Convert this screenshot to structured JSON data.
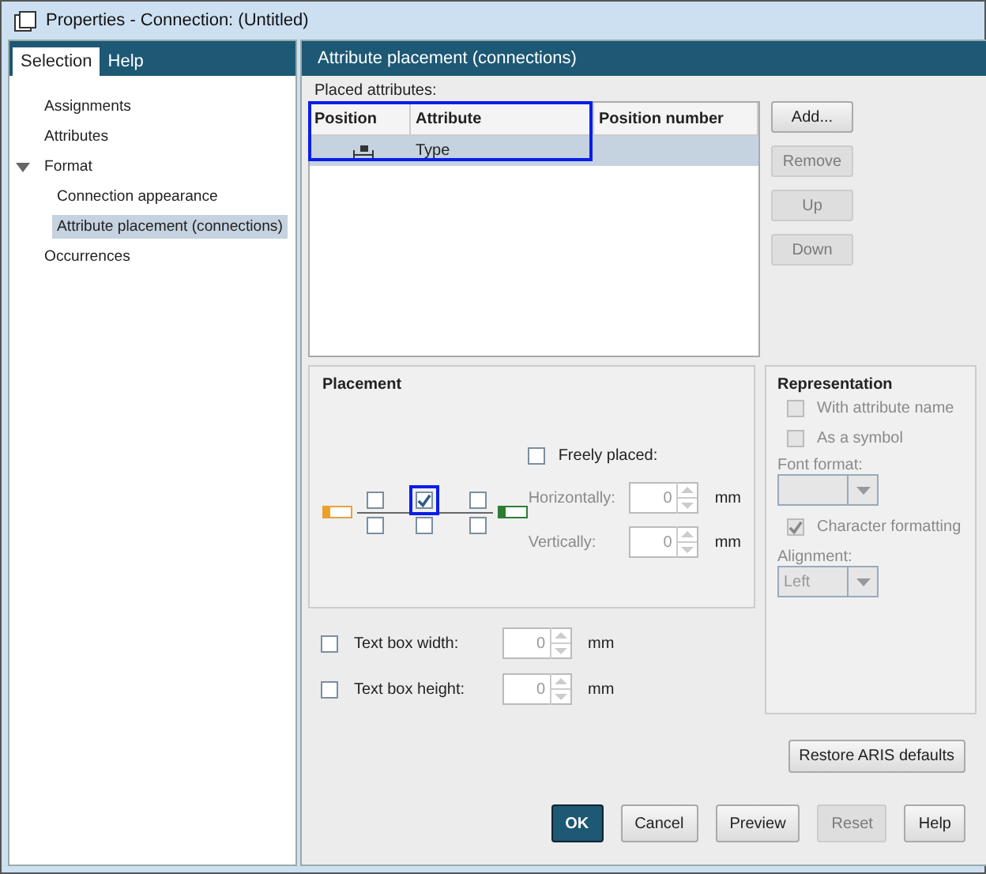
{
  "window": {
    "title": "Properties - Connection: (Untitled)"
  },
  "sidebar": {
    "tabs": [
      {
        "label": "Selection",
        "selected": true
      },
      {
        "label": "Help",
        "selected": false
      }
    ],
    "items": [
      {
        "label": "Assignments",
        "selected": false
      },
      {
        "label": "Attributes",
        "selected": false
      },
      {
        "label": "Format",
        "selected": false,
        "expanded": true,
        "children": [
          {
            "label": "Connection appearance",
            "selected": false
          },
          {
            "label": "Attribute placement (connections)",
            "selected": true
          }
        ]
      },
      {
        "label": "Occurrences",
        "selected": false
      }
    ]
  },
  "page": {
    "title": "Attribute placement (connections)",
    "placed_attributes": {
      "label": "Placed attributes:",
      "highlighted": true,
      "columns": [
        "Position",
        "Attribute",
        "Position number"
      ],
      "rows": [
        {
          "attribute": "Type",
          "selected": true
        }
      ]
    },
    "list_buttons": [
      {
        "label": "Add...",
        "disabled": false
      },
      {
        "label": "Remove",
        "disabled": true
      },
      {
        "label": "Up",
        "disabled": true
      },
      {
        "label": "Down",
        "disabled": true
      }
    ],
    "placement": {
      "title": "Placement",
      "positions": [
        {
          "checked": false
        },
        {
          "checked": true
        },
        {
          "checked": false
        },
        {
          "checked": false
        },
        {
          "checked": false
        },
        {
          "checked": false
        }
      ],
      "freely_placed": {
        "label": "Freely placed:",
        "checked": false
      },
      "fields": [
        {
          "label": "Horizontally:",
          "value": "0",
          "unit": "mm",
          "disabled": true
        },
        {
          "label": "Vertically:",
          "value": "0",
          "unit": "mm",
          "disabled": true
        }
      ]
    },
    "text_box": [
      {
        "label": "Text box width:",
        "checked": false,
        "value": "0",
        "unit": "mm"
      },
      {
        "label": "Text box height:",
        "checked": false,
        "value": "0",
        "unit": "mm"
      }
    ],
    "representation": {
      "title": "Representation",
      "options": [
        {
          "label": "With attribute name",
          "checked": false,
          "disabled": true
        },
        {
          "label": "As a symbol",
          "checked": false,
          "disabled": true
        }
      ],
      "font_format": {
        "label": "Font format:",
        "disabled": true
      },
      "character_formatting": {
        "label": "Character formatting",
        "checked": true,
        "disabled": true
      },
      "alignment": {
        "label": "Alignment:",
        "value": "Left",
        "disabled": true
      }
    },
    "restore_button": "Restore ARIS defaults"
  },
  "buttons": [
    {
      "label": "OK",
      "kind": "primary",
      "disabled": false
    },
    {
      "label": "Cancel",
      "kind": "normal",
      "disabled": false
    },
    {
      "label": "Preview",
      "kind": "normal",
      "disabled": false
    },
    {
      "label": "Reset",
      "kind": "normal",
      "disabled": true
    },
    {
      "label": "Help",
      "kind": "normal",
      "disabled": false
    }
  ]
}
